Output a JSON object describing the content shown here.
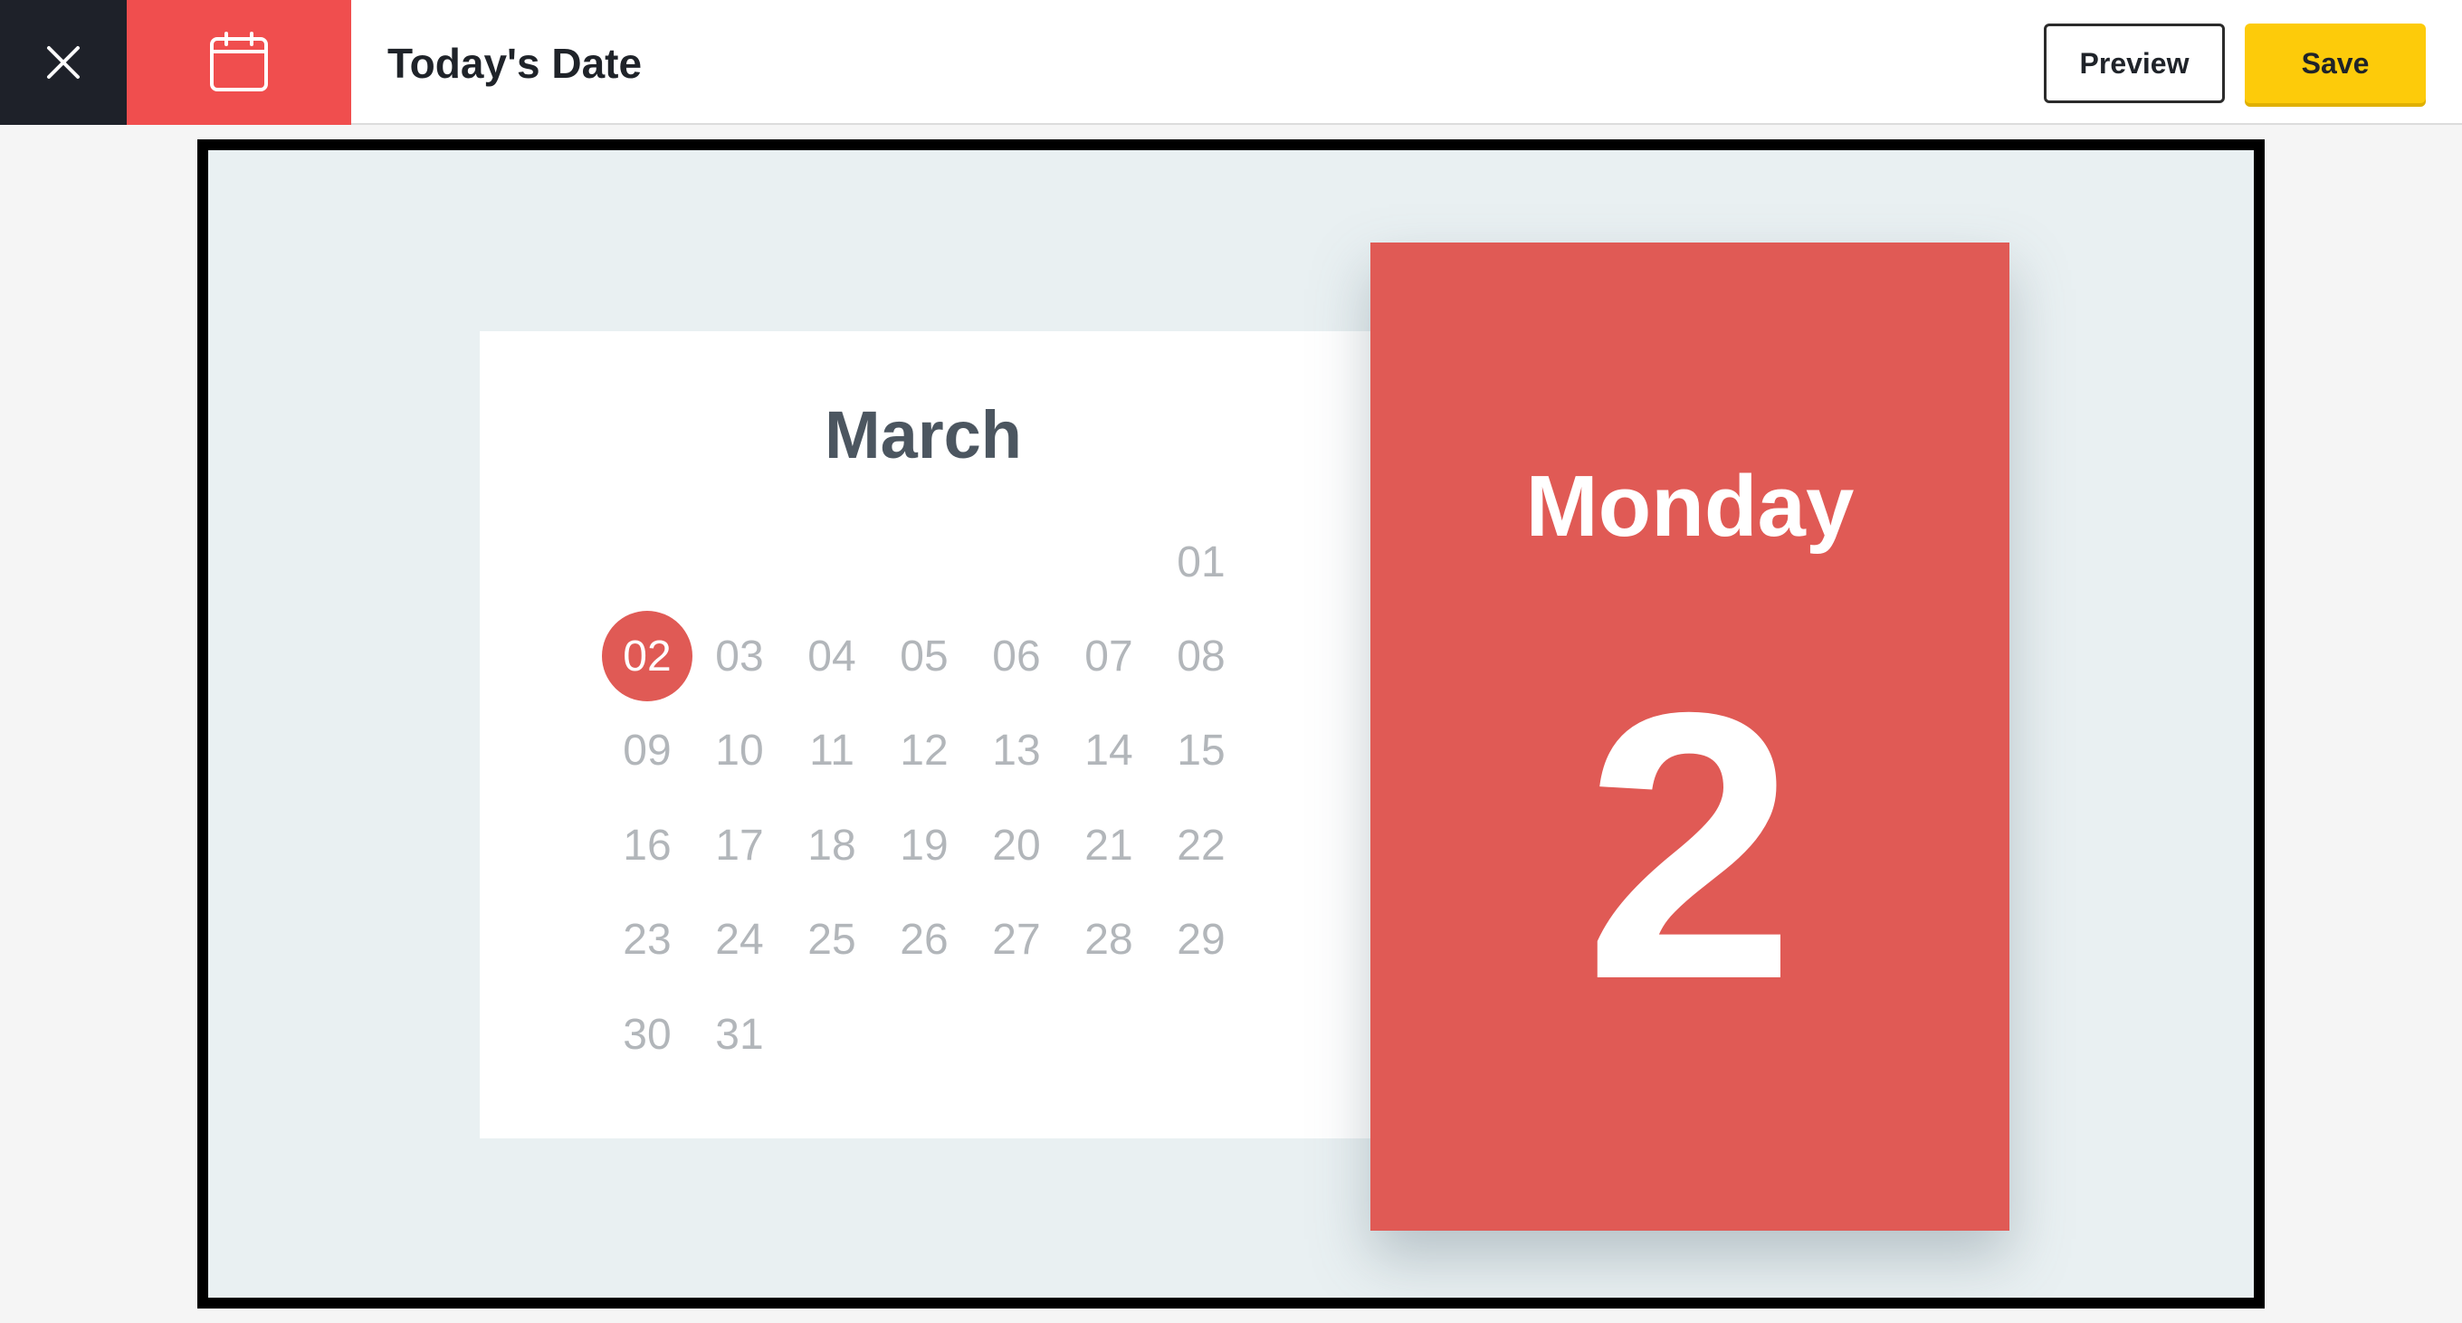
{
  "header": {
    "title": "Today's Date",
    "icons": {
      "close": "close-icon",
      "app": "calendar-icon"
    },
    "preview_label": "Preview",
    "save_label": "Save"
  },
  "calendar": {
    "month": "March",
    "selected_day": "02",
    "weeks": [
      [
        "",
        "",
        "",
        "",
        "",
        "",
        "01"
      ],
      [
        "02",
        "03",
        "04",
        "05",
        "06",
        "07",
        "08"
      ],
      [
        "09",
        "10",
        "11",
        "12",
        "13",
        "14",
        "15"
      ],
      [
        "16",
        "17",
        "18",
        "19",
        "20",
        "21",
        "22"
      ],
      [
        "23",
        "24",
        "25",
        "26",
        "27",
        "28",
        "29"
      ],
      [
        "30",
        "31",
        "",
        "",
        "",
        "",
        ""
      ]
    ]
  },
  "today": {
    "weekday": "Monday",
    "day": "2"
  },
  "colors": {
    "accent_red": "#e05a55",
    "brand_red": "#f04e4e",
    "save_yellow": "#fdcb0a",
    "dark": "#1e2129"
  }
}
